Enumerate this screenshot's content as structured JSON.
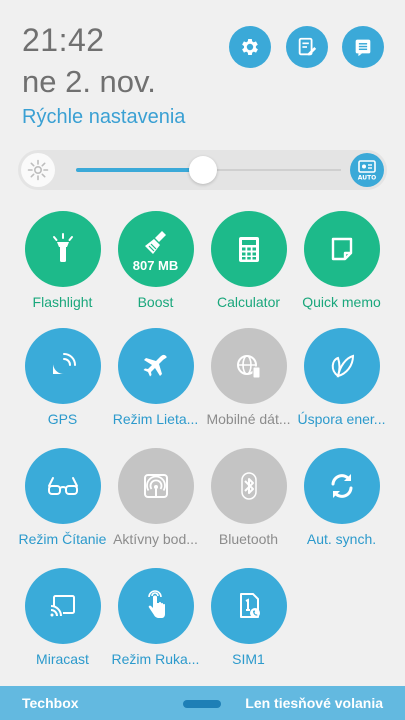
{
  "header": {
    "time": "21:42",
    "date": "ne 2. nov.",
    "subtitle": "Rýchle nastavenia",
    "buttons": [
      "settings-icon",
      "edit-icon",
      "list-icon"
    ]
  },
  "brightness": {
    "level_percent": 48,
    "auto_label": "AUTO"
  },
  "tiles": [
    {
      "label": "Flashlight",
      "state": "active",
      "color": "#1dba8a",
      "icon": "flashlight-icon"
    },
    {
      "label": "Boost",
      "badge": "807 MB",
      "state": "active",
      "color": "#1dba8a",
      "icon": "broom-icon"
    },
    {
      "label": "Calculator",
      "state": "active",
      "color": "#1dba8a",
      "icon": "calculator-icon"
    },
    {
      "label": "Quick memo",
      "state": "active",
      "color": "#1dba8a",
      "icon": "memo-icon"
    },
    {
      "label": "GPS",
      "state": "on",
      "color": "#3aabd9",
      "icon": "satellite-icon"
    },
    {
      "label": "Režim Lieta...",
      "state": "on",
      "color": "#3aabd9",
      "icon": "airplane-icon"
    },
    {
      "label": "Mobilné dát...",
      "state": "off",
      "color": "#c4c4c4",
      "icon": "mobile-data-icon"
    },
    {
      "label": "Úspora ener...",
      "state": "on",
      "color": "#3aabd9",
      "icon": "leaf-icon"
    },
    {
      "label": "Režim Čítanie",
      "state": "on",
      "color": "#3aabd9",
      "icon": "glasses-icon"
    },
    {
      "label": "Aktívny bod...",
      "state": "off",
      "color": "#c4c4c4",
      "icon": "hotspot-icon"
    },
    {
      "label": "Bluetooth",
      "state": "off",
      "color": "#c4c4c4",
      "icon": "bluetooth-icon"
    },
    {
      "label": "Aut. synch.",
      "state": "on",
      "color": "#3aabd9",
      "icon": "sync-icon"
    },
    {
      "label": "Miracast",
      "state": "on",
      "color": "#3aabd9",
      "icon": "cast-icon"
    },
    {
      "label": "Režim Ruka...",
      "state": "on",
      "color": "#3aabd9",
      "icon": "glove-icon"
    },
    {
      "label": "SIM1",
      "state": "on",
      "color": "#3aabd9",
      "icon": "sim-icon"
    }
  ],
  "footer": {
    "carrier": "Techbox",
    "emergency": "Len tiesňové volania"
  },
  "colors": {
    "accent_blue": "#3aabd9",
    "accent_green": "#1dba8a",
    "disabled_gray": "#c4c4c4",
    "footer_bg": "#63b9e0"
  }
}
